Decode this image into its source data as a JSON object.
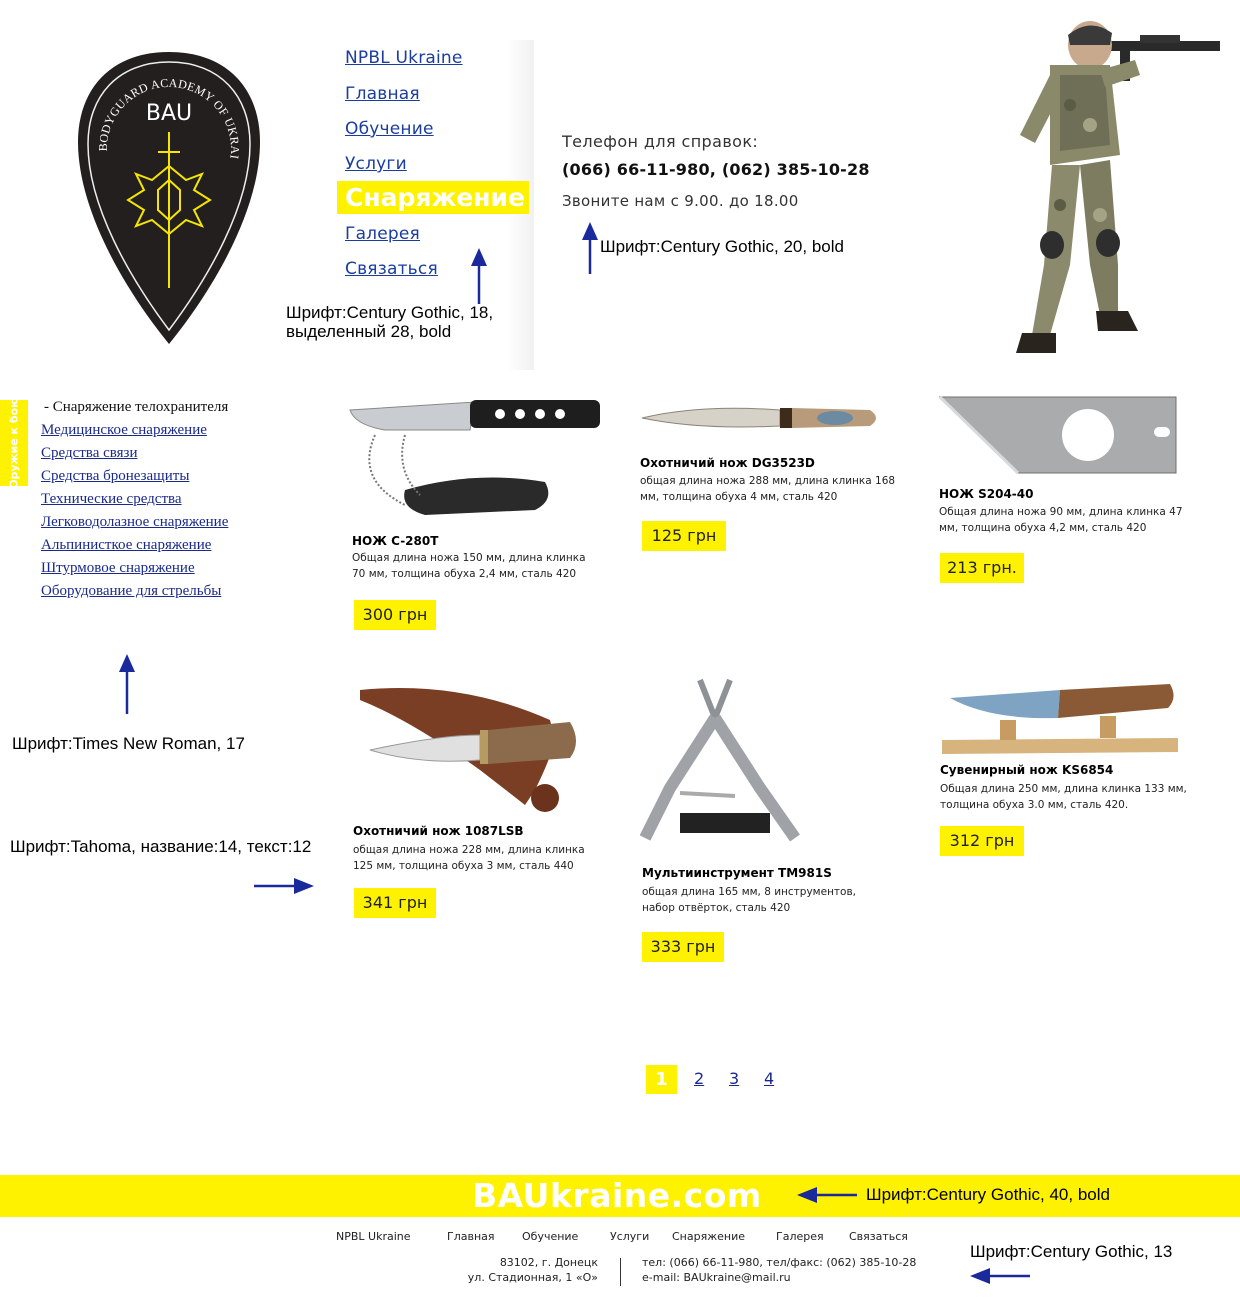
{
  "logo": {
    "ring_text": "BODYGUARD ACADEMY OF UKRAINE",
    "abbr": "BAU"
  },
  "nav": {
    "items": [
      "NPBL Ukraine",
      "Главная",
      "Обучение",
      "Услуги",
      "Снаряжение",
      "Галерея",
      "Связаться"
    ],
    "active": "Снаряжение"
  },
  "contact": {
    "label": "Телефон для справок:",
    "phones": "(066) 66-11-980, (062) 385-10-28",
    "hours": "Звоните нам с 9.00. до 18.00"
  },
  "side_tab": "Оружие к бою",
  "categories": {
    "heading": "- Снаряжение телохранителя",
    "links": [
      "Медицинское снаряжение",
      "Средства связи",
      "Средства бронезащиты",
      "Технические средства",
      "Легководолазное снаряжение",
      "Альпинисткое снаряжение",
      "Штурмовое снаряжение",
      "Оборудование для стрельбы"
    ]
  },
  "products": [
    {
      "name": "НОЖ C-280T",
      "desc": "Общая длина ножа 150 мм, длина клинка 70 мм, толщина обуха 2,4 мм, сталь 420",
      "price": "300 грн"
    },
    {
      "name": "Охотничий нож DG3523D",
      "desc": "общая длина ножа 288 мм, длина клинка 168 мм, толщина обуха 4 мм, сталь 420",
      "price": "125 грн"
    },
    {
      "name": "НОЖ S204-40",
      "desc": "Общая длина ножа 90 мм, длина клинка 47 мм, толщина обуха 4,2 мм, сталь 420",
      "price": "213 грн."
    },
    {
      "name": "Охотничий нож 1087LSB",
      "desc": "общая длина ножа 228 мм, длина клинка 125 мм, толщина обуха 3 мм, сталь 440",
      "price": "341 грн"
    },
    {
      "name": "Мультиинструмент TM981S",
      "desc": "общая длина 165 мм, 8 инструментов, набор отвёрток, сталь 420",
      "price": "333 грн"
    },
    {
      "name": "Сувенирный нож KS6854",
      "desc": "Общая длина 250 мм, длина клинка 133 мм, толщина обуха 3.0 мм, сталь 420.",
      "price": "312 грн"
    }
  ],
  "pagination": {
    "current": "1",
    "pages": [
      "2",
      "3",
      "4"
    ]
  },
  "notes": {
    "nav_font": "Шрифт:Century Gothic, 18,",
    "nav_font2": "выделенный 28, bold",
    "contact_font": "Шрифт:Century Gothic, 20, bold",
    "cat_font": "Шрифт:Times New Roman, 17",
    "prod_font": "Шрифт:Tahoma, название:14, текст:12",
    "brand_font": "Шрифт:Century Gothic, 40, bold",
    "footer_font": "Шрифт:Century Gothic, 13"
  },
  "footer": {
    "brand": "BAUkraine.com",
    "links": [
      "NPBL Ukraine",
      "Главная",
      "Обучение",
      "Услуги",
      "Снаряжение",
      "Галерея",
      "Связаться"
    ],
    "address1": "83102, г. Донецк",
    "address2": "ул. Стадионная, 1 «О»",
    "phone": "тел: (066) 66-11-980, тел/факс: (062) 385-10-28",
    "email": "e-mail: BAUkraine@mail.ru"
  },
  "colors": {
    "accent": "#fff200",
    "link": "#1a3d9e",
    "arrow": "#1a2a9c",
    "logo_bg": "#231f1e"
  }
}
